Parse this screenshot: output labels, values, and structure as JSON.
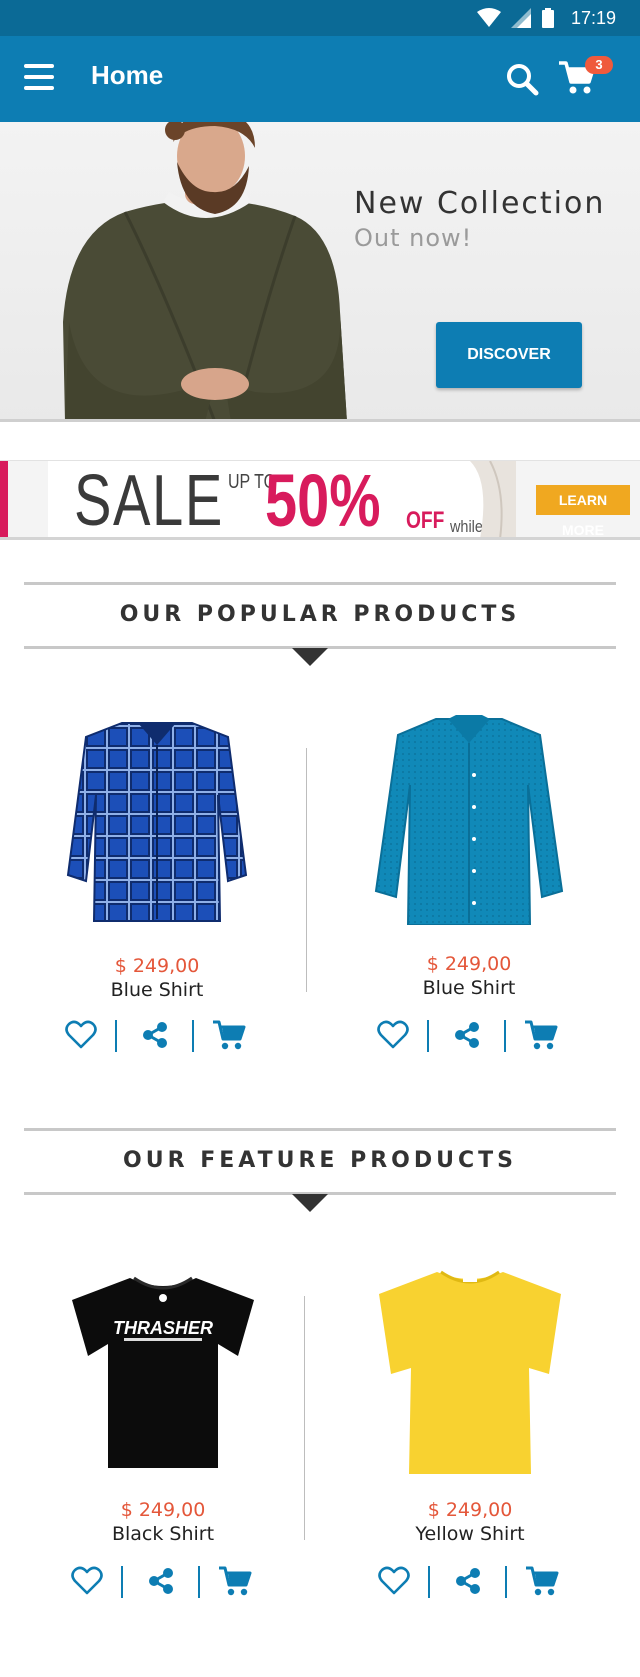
{
  "status_bar": {
    "time": "17:19",
    "icons": [
      "wifi-icon",
      "signal-icon",
      "battery-icon"
    ]
  },
  "app_bar": {
    "title": "Home",
    "cart_count": "3",
    "icons": [
      "menu-icon",
      "search-icon",
      "cart-icon"
    ]
  },
  "hero": {
    "title": "New Collection",
    "subtitle": "Out now!",
    "button_label": "DISCOVER"
  },
  "sale_banner": {
    "sale_word": "SALE",
    "up_to": "UP TO",
    "percent": "50%",
    "off": "OFF",
    "stock_note": "while stock",
    "learn_more": "LEARN MORE"
  },
  "popular": {
    "title": "OUR POPULAR PRODUCTS",
    "products": [
      {
        "price": "$ 249,00",
        "name": "Blue Shirt",
        "image": "plaid-shirt-image"
      },
      {
        "price": "$ 249,00",
        "name": "Blue Shirt",
        "image": "teal-shirt-image"
      }
    ]
  },
  "featured": {
    "title": "OUR FEATURE PRODUCTS",
    "products": [
      {
        "price": "$ 249,00",
        "name": "Black Shirt",
        "image": "black-tshirt-image",
        "print": "THRASHER"
      },
      {
        "price": "$ 249,00",
        "name": "Yellow Shirt",
        "image": "yellow-tshirt-image"
      }
    ]
  },
  "colors": {
    "primary": "#0d7db3",
    "status_bar": "#0b6a96",
    "price": "#e4573a",
    "sale_pink": "#d81b5c",
    "badge": "#ef5a3c"
  }
}
